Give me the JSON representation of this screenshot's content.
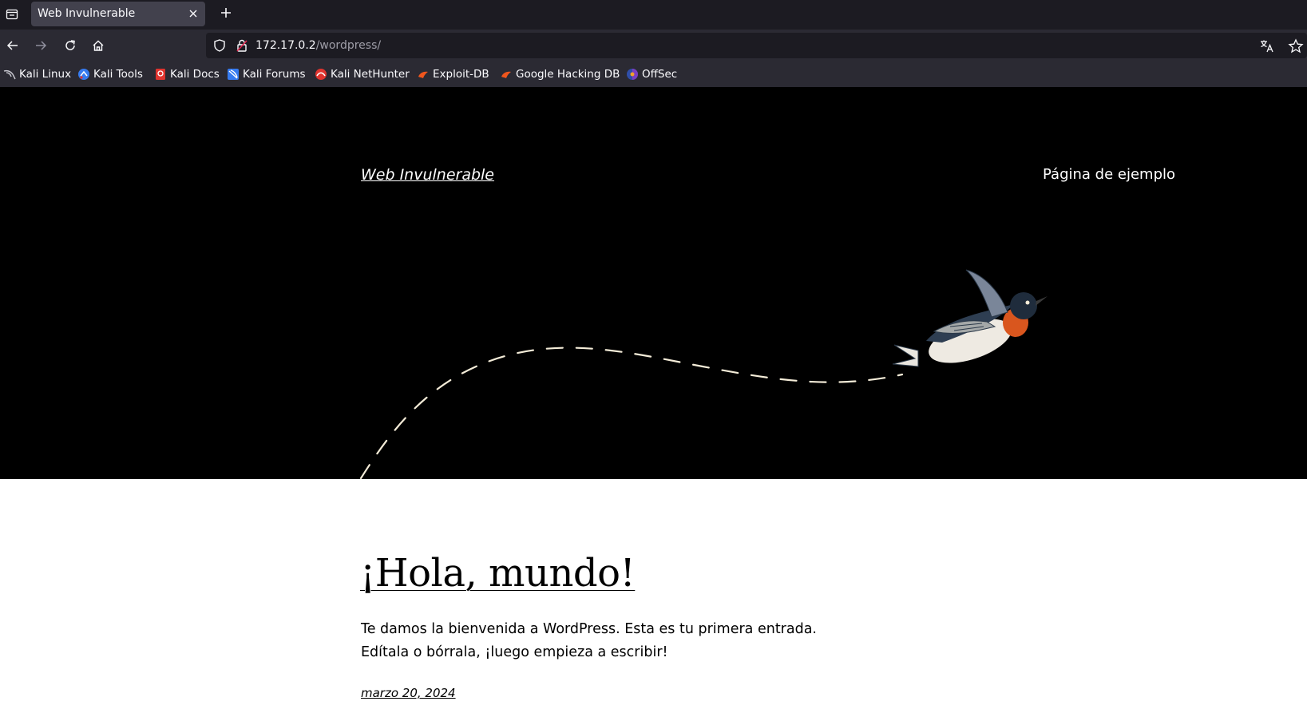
{
  "browser": {
    "tab": {
      "title": "Web Invulnerable"
    },
    "url": {
      "host": "172.17.0.2",
      "path": "/wordpress/"
    },
    "bookmarks": [
      {
        "label": "Kali Linux",
        "icon": "kali-dragon-icon"
      },
      {
        "label": "Kali Tools",
        "icon": "kali-tools-icon"
      },
      {
        "label": "Kali Docs",
        "icon": "kali-docs-icon"
      },
      {
        "label": "Kali Forums",
        "icon": "kali-forums-icon"
      },
      {
        "label": "Kali NetHunter",
        "icon": "kali-nethunter-icon"
      },
      {
        "label": "Exploit-DB",
        "icon": "exploit-db-icon"
      },
      {
        "label": "Google Hacking DB",
        "icon": "ghdb-icon"
      },
      {
        "label": "OffSec",
        "icon": "offsec-icon"
      }
    ]
  },
  "site": {
    "title": "Web Invulnerable",
    "nav": {
      "sample_page": "Página de ejemplo"
    }
  },
  "post": {
    "title": "¡Hola, mundo!",
    "excerpt": "Te damos la bienvenida a WordPress. Esta es tu primera entrada. Edítala o bórrala, ¡luego empieza a escribir!",
    "date": "marzo 20, 2024"
  },
  "colors": {
    "hero_background": "#000000",
    "chrome_dark": "#1c1b22",
    "chrome_toolbar": "#2b2a33",
    "text_light": "#fbfbfe"
  }
}
